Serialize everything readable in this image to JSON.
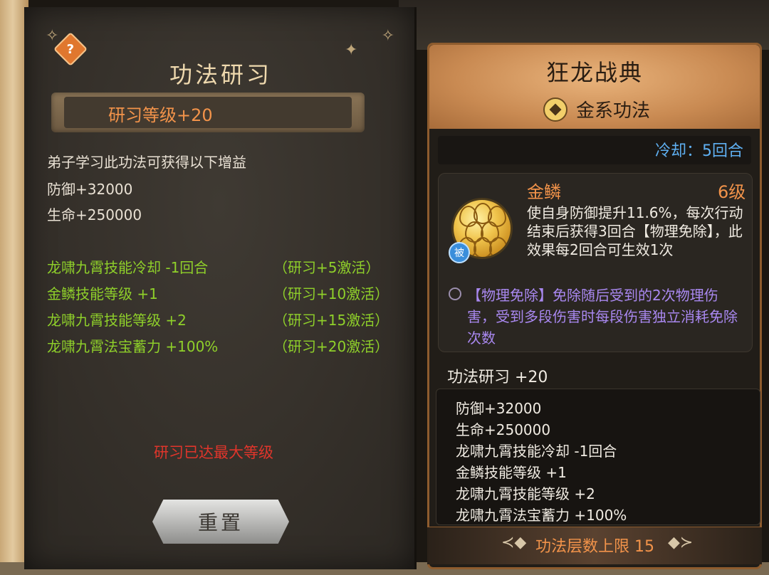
{
  "left": {
    "title": "功法研习",
    "level": "研习等级+20",
    "intro": "弟子学习此功法可获得以下增益",
    "stats": [
      "防御+32000",
      "生命+250000"
    ],
    "bonuses": [
      {
        "text": "龙啸九霄技能冷却 -1回合",
        "activation": "（研习+5激活）"
      },
      {
        "text": "金鳞技能等级 +1",
        "activation": "（研习+10激活）"
      },
      {
        "text": "龙啸九霄技能等级 +2",
        "activation": "（研习+15激活）"
      },
      {
        "text": "龙啸九霄法宝蓄力 +100%",
        "activation": "（研习+20激活）"
      }
    ],
    "max_notice": "研习已达最大等级",
    "reset_label": "重置",
    "help_glyph": "?"
  },
  "right": {
    "title": "狂龙战典",
    "school": "金系功法",
    "cooldown": "冷却：5回合",
    "skill": {
      "name": "金鳞",
      "level": "6级",
      "badge": "被",
      "description": "使自身防御提升11.6%，每次行动结束后获得3回合【物理免除】，此效果每2回合可生效1次",
      "term": "【物理免除】免除随后受到的2次物理伤害，受到多段伤害时每段伤害独立消耗免除次数"
    },
    "study_title": "功法研习 +20",
    "study_lines": [
      "防御+32000",
      "生命+250000",
      "龙啸九霄技能冷却 -1回合",
      "金鳞技能等级 +1",
      "龙啸九霄技能等级 +2",
      "龙啸九霄法宝蓄力 +100%"
    ],
    "footer": "功法层数上限 15"
  },
  "icons": {
    "help": "help-icon",
    "school": "metal-element-icon",
    "skill": "golden-scale-icon",
    "passive": "passive-badge-icon"
  },
  "colors": {
    "accent_orange": "#f2934a",
    "bonus_green": "#8fd02a",
    "max_red": "#e0352b",
    "cooldown_blue": "#5fb0f2",
    "term_purple": "#a988f0"
  }
}
